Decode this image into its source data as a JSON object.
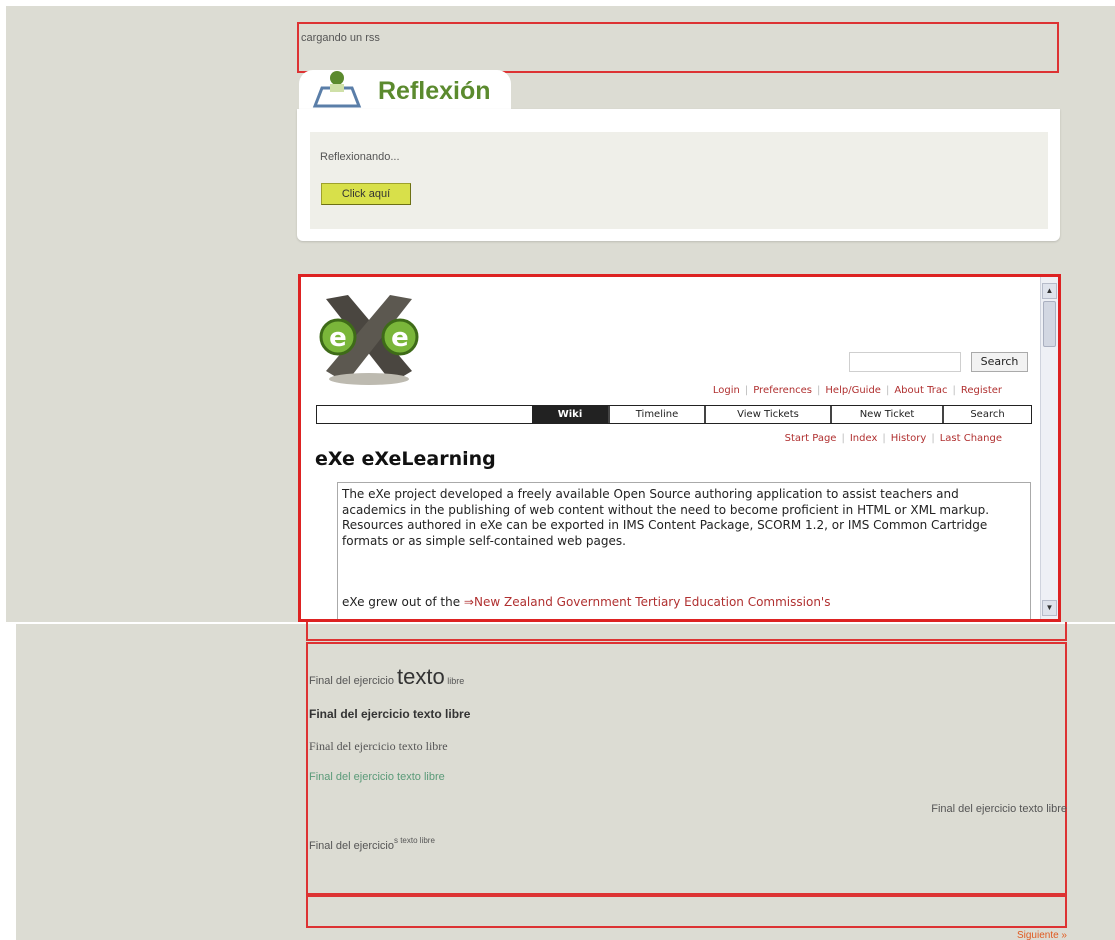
{
  "top": {
    "loading_text": "cargando un rss"
  },
  "reflection": {
    "title": "Reflexión",
    "text": "Reflexionando...",
    "button_label": "Click aquí"
  },
  "trac": {
    "search_button": "Search",
    "metanav": [
      "Login",
      "Preferences",
      "Help/Guide",
      "About Trac",
      "Register"
    ],
    "mainnav": [
      "Wiki",
      "Timeline",
      "View Tickets",
      "New Ticket",
      "Search"
    ],
    "ctxnav": [
      "Start Page",
      "Index",
      "History",
      "Last Change"
    ],
    "page_title": "eXe eXeLearning",
    "paragraph1": "The eXe project developed a freely available Open Source authoring application to assist teachers and academics in the publishing of web content without the need to become proficient in HTML or XML markup. Resources authored in eXe can be exported in IMS Content Package, SCORM 1.2, or IMS Common Cartridge formats or as simple self-contained web pages.",
    "paragraph2_prefix": "eXe grew out of the ",
    "paragraph2_link": "New Zealand Government Tertiary Education Commission's"
  },
  "final": {
    "line1_a": "Final del ejercicio ",
    "line1_big": "texto",
    "line1_small": " libre",
    "line2": "Final del ejercicio texto libre",
    "line3": "Final del ejercicio texto libre",
    "line4": "Final del ejercicio texto libre",
    "line5": "Final del ejercicio texto libre",
    "line6_a": "Final del ejercicio",
    "line6_sup": "s texto libre"
  },
  "next_link": "Siguiente »",
  "colors": {
    "background": "#dcdcd3",
    "frame_red": "#dd3333",
    "reflection_green": "#5b8a2e",
    "button_yellow": "#d8e04a",
    "link_red": "#b03030"
  }
}
